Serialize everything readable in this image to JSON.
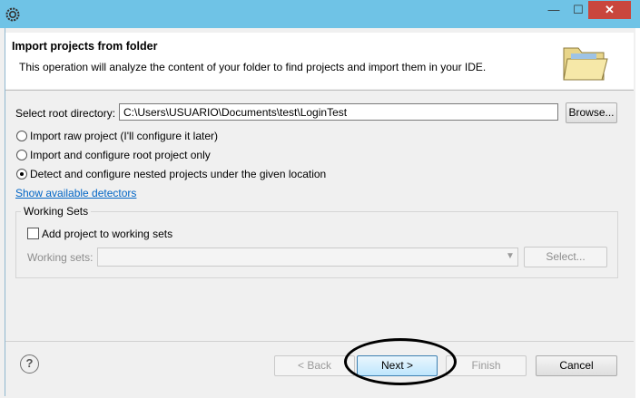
{
  "dialog": {
    "title_bar": {
      "min_glyph": "—",
      "max_glyph": "☐",
      "close_glyph": "✕"
    },
    "banner": {
      "title": "Import projects from folder",
      "description": "This operation will analyze the content of your folder to find projects and import them in your IDE."
    },
    "root_directory": {
      "label": "Select root directory:",
      "value": "C:\\Users\\USUARIO\\Documents\\test\\LoginTest",
      "browse_label": "Browse..."
    },
    "options": [
      {
        "label": "Import raw project (I'll configure it later)",
        "selected": false
      },
      {
        "label": "Import and configure root project only",
        "selected": false
      },
      {
        "label": "Detect and configure nested projects under the given location",
        "selected": true
      }
    ],
    "detectors_link": "Show available detectors",
    "working_sets": {
      "group_title": "Working Sets",
      "add_label": "Add project to working sets",
      "add_checked": false,
      "sets_label": "Working sets:",
      "select_label": "Select..."
    },
    "buttons": {
      "help_glyph": "?",
      "back": "< Back",
      "next": "Next >",
      "finish": "Finish",
      "cancel": "Cancel"
    }
  },
  "colors": {
    "title_bar": "#6fc3e6",
    "close_button": "#c9463d",
    "link": "#0065c6",
    "disabled_text": "#8d8d8d"
  }
}
